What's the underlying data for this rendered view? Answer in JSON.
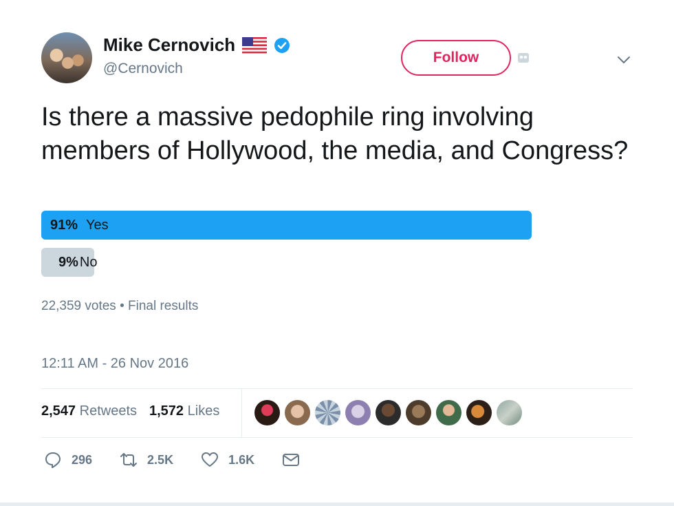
{
  "tweet": {
    "author_name": "Mike Cernovich",
    "handle": "@Cernovich",
    "follow_label": "Follow",
    "text": "Is there a massive pedophile ring involving members of Hollywood, the media, and Congress?",
    "timestamp": "12:11 AM - 26 Nov 2016"
  },
  "poll": {
    "options": [
      {
        "percent": "91%",
        "label": "Yes",
        "share": 0.91,
        "color": "#1da1f2"
      },
      {
        "percent": "9%",
        "label": "No",
        "share": 0.09,
        "color": "#ccd6dd"
      }
    ],
    "meta": "22,359 votes • Final results"
  },
  "stats": {
    "retweets_count": "2,547",
    "retweets_label": "Retweets",
    "likes_count": "1,572",
    "likes_label": "Likes"
  },
  "actions": {
    "replies": "296",
    "retweets": "2.5K",
    "likes": "1.6K"
  },
  "colors": {
    "accent": "#1da1f2",
    "follow": "#e0245e",
    "muted": "#657786"
  },
  "icons": [
    "flag-usa-icon",
    "verified-badge-icon",
    "chevron-down-icon",
    "reply-icon",
    "retweet-icon",
    "heart-icon",
    "message-icon"
  ]
}
